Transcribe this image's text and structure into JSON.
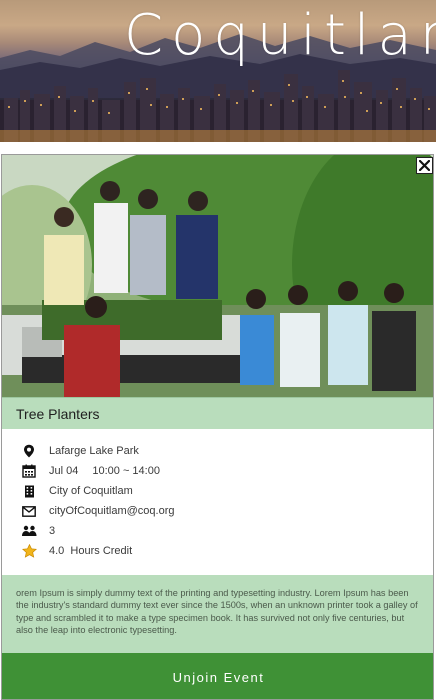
{
  "app": {
    "title": "Coquitlam"
  },
  "event": {
    "title": "Tree Planters",
    "location": "Lafarge Lake Park",
    "date": "Jul 04",
    "time": "10:00 ~ 14:00",
    "organizer": "City of Coquitlam",
    "email": "cityOfCoquitlam@coq.org",
    "participants": "3",
    "credit_value": "4.0",
    "credit_label": "Hours Credit",
    "description": "orem Ipsum is simply dummy text of the printing and typesetting industry. Lorem Ipsum has been the industry's standard dummy text ever since the 1500s, when an unknown printer took a galley of type and scrambled it to make a type specimen book. It has survived not only five centuries, but also the leap into electronic typesetting.",
    "action_label": "Unjoin Event"
  },
  "icons": {
    "close": "close-icon",
    "location": "location-pin-icon",
    "calendar": "calendar-icon",
    "organizer": "building-icon",
    "email": "envelope-icon",
    "participants": "people-icon",
    "credit": "star-icon"
  },
  "colors": {
    "accent_light": "#b9ddbc",
    "accent_dark": "#3f9136",
    "star": "#f2b51b"
  }
}
